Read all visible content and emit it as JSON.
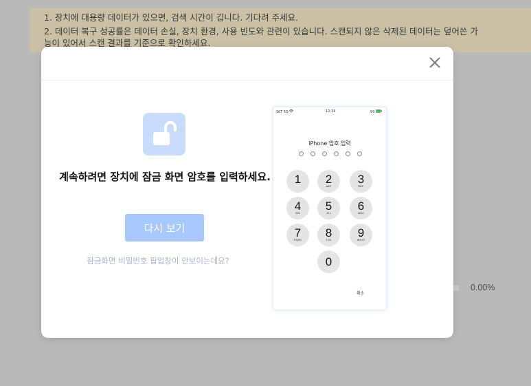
{
  "notice": {
    "line1": "1. 장치에 대용량 데이터가 있으면, 검색 시간이 깁니다. 기다려 주세요.",
    "line2": "2. 데이터 복구 성공률은 데이터 손실, 장치 환경, 사용 빈도와 관련이 있습니다. 스캔되지 않은 삭제된 데이터는 덮어쓴 가",
    "line3": "능이 있어서 스캔 결과를 기준으로 확인하세요."
  },
  "progress": {
    "percent_text": "0.00%"
  },
  "modal": {
    "instruction": "계속하려면 장치에 잠금 화면 암호를 입력하세요.",
    "retry_label": "다시 보기",
    "help_link": "잠금화면 비밀번호 팝업창이 안보이는데요?"
  },
  "phone": {
    "status_left": "SKT 5G",
    "status_mid": "12:34",
    "status_right": "99",
    "title": "iPhone 암호 입력",
    "passcode_length": 6,
    "keys": [
      {
        "num": "1",
        "letters": ""
      },
      {
        "num": "2",
        "letters": "ABC"
      },
      {
        "num": "3",
        "letters": "DEF"
      },
      {
        "num": "4",
        "letters": "GHI"
      },
      {
        "num": "5",
        "letters": "JKL"
      },
      {
        "num": "6",
        "letters": "MNO"
      },
      {
        "num": "7",
        "letters": "PQRS"
      },
      {
        "num": "8",
        "letters": "TUV"
      },
      {
        "num": "9",
        "letters": "WXYZ"
      },
      {
        "num": "0",
        "letters": ""
      }
    ],
    "cancel": "취소"
  },
  "colors": {
    "overlay": "#b9b9b9",
    "notice_bg": "#c9c0a6",
    "accent_light": "#a7c8fc",
    "lock_tile": "#c9dbfd"
  },
  "icons": {
    "close": "close-icon",
    "lock": "unlock-padlock-icon",
    "wifi": "wifi-icon",
    "battery": "battery-icon"
  }
}
